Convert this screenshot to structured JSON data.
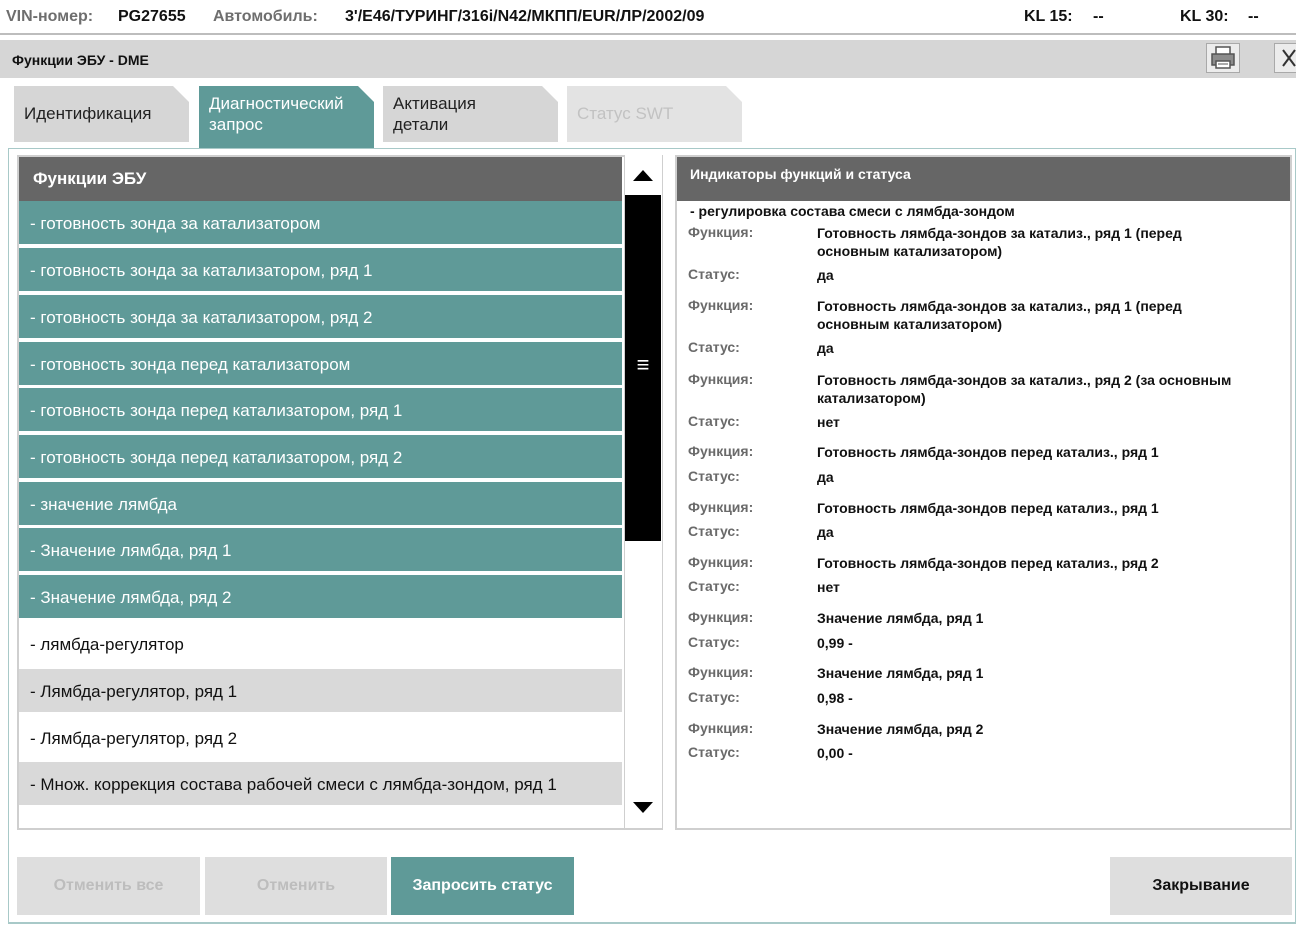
{
  "topbar": {
    "vin_label": "VIN-номер:",
    "vin_value": "PG27655",
    "car_label": "Автомобиль:",
    "car_value": "3'/E46/ТУРИНГ/316i/N42/МКПП/EUR/ЛР/2002/09",
    "kl15_label": "KL 15:",
    "kl15_value": "--",
    "kl30_label": "KL 30:",
    "kl30_value": "--"
  },
  "window": {
    "title": "Функции ЭБУ - DME",
    "print_icon": "printer-icon",
    "close_icon": "close-icon"
  },
  "tabs": [
    {
      "line1": "Идентификация",
      "line2": "",
      "state": "normal"
    },
    {
      "line1": "Диагностический",
      "line2": "запрос",
      "state": "active"
    },
    {
      "line1": "Активация",
      "line2": "детали",
      "state": "normal"
    },
    {
      "line1": "Статус SWT",
      "line2": "",
      "state": "disabled"
    }
  ],
  "list": {
    "header": "Функции ЭБУ",
    "items": [
      {
        "label": "- готовность зонда за катализатором",
        "state": "selected"
      },
      {
        "label": "- готовность зонда за катализатором, ряд 1",
        "state": "selected"
      },
      {
        "label": "- готовность зонда за катализатором, ряд 2",
        "state": "selected"
      },
      {
        "label": "- готовность зонда перед катализатором",
        "state": "selected"
      },
      {
        "label": "- готовность зонда перед катализатором, ряд 1",
        "state": "selected"
      },
      {
        "label": "- готовность зонда перед катализатором, ряд 2",
        "state": "selected"
      },
      {
        "label": "- значение лямбда",
        "state": "selected"
      },
      {
        "label": "- Значение лямбда, ряд 1",
        "state": "selected"
      },
      {
        "label": "- Значение лямбда, ряд 2",
        "state": "selected"
      },
      {
        "label": "- лямбда-регулятор",
        "state": "white"
      },
      {
        "label": "- Лямбда-регулятор, ряд 1",
        "state": "gray"
      },
      {
        "label": "- Лямбда-регулятор, ряд 2",
        "state": "white"
      },
      {
        "label": "- Множ. коррекция состава рабочей смеси с лямбда-зондом, ряд 1",
        "state": "gray"
      }
    ],
    "scroll_grip_icon": "scroll-grip-icon"
  },
  "status_panel": {
    "header": "Индикаторы функций и статуса",
    "subtitle": "- регулировка состава смеси с лямбда-зондом",
    "function_label": "Функция:",
    "status_label": "Статус:",
    "entries": [
      {
        "function": "Готовность лямбда-зондов за катализ., ряд 1 (перед основным катализатором)",
        "status": "да"
      },
      {
        "function": "Готовность лямбда-зондов за катализ., ряд 1 (перед основным катализатором)",
        "status": "да"
      },
      {
        "function": "Готовность лямбда-зондов за катализ., ряд 2 (за основным катализатором)",
        "status": "нет"
      },
      {
        "function": "Готовность лямбда-зондов перед катализ., ряд 1",
        "status": "да"
      },
      {
        "function": "Готовность лямбда-зондов перед катализ., ряд 1",
        "status": "да"
      },
      {
        "function": "Готовность лямбда-зондов перед катализ., ряд 2",
        "status": "нет"
      },
      {
        "function": "Значение лямбда, ряд 1",
        "status": "0,99  -"
      },
      {
        "function": "Значение лямбда, ряд 1",
        "status": "0,98  -"
      },
      {
        "function": "Значение лямбда, ряд 2",
        "status": "0,00  -"
      }
    ]
  },
  "buttons": {
    "cancel_all": "Отменить все",
    "cancel": "Отменить",
    "request_status": "Запросить статус",
    "close": "Закрывание"
  },
  "colors": {
    "accent": "#5f9a98",
    "header_gray": "#666666",
    "row_gray": "#d9d9d9"
  }
}
